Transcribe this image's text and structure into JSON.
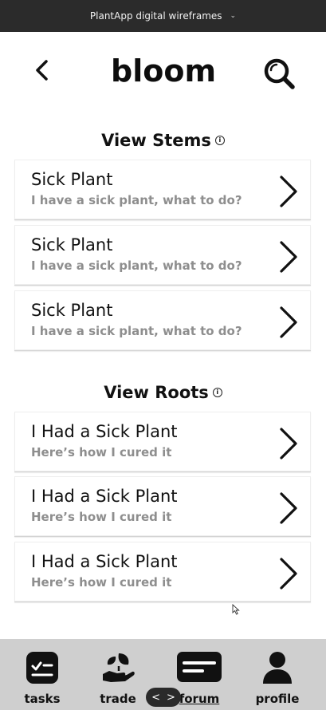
{
  "topbar": {
    "title": "PlantApp digital wireframes",
    "caret": "ˇ"
  },
  "header": {
    "logo": "bloom",
    "back_icon": "chevron-left-icon",
    "search_icon": "search-icon"
  },
  "stems": {
    "title": "View Stems",
    "items": [
      {
        "title": "Sick Plant",
        "subtitle": "I have a sick plant, what to do?"
      },
      {
        "title": "Sick Plant",
        "subtitle": "I have a sick plant, what to do?"
      },
      {
        "title": "Sick Plant",
        "subtitle": "I have a sick plant, what to do?"
      }
    ]
  },
  "roots": {
    "title": "View Roots",
    "items": [
      {
        "title": "I Had a Sick Plant",
        "subtitle": "Here’s how I cured it"
      },
      {
        "title": "I Had a Sick Plant",
        "subtitle": "Here’s how I cured it"
      },
      {
        "title": "I Had a Sick Plant",
        "subtitle": "Here’s how I cured it"
      }
    ]
  },
  "nav": {
    "items": [
      {
        "label": "tasks",
        "icon": "tasks-icon"
      },
      {
        "label": "trade",
        "icon": "trade-icon"
      },
      {
        "label": "forum",
        "icon": "forum-icon",
        "active": true
      },
      {
        "label": "profile",
        "icon": "profile-icon"
      }
    ]
  },
  "pager": {
    "prev": "<",
    "next": ">"
  },
  "colors": {
    "topbar": "#2b2b2b",
    "nav_bg": "#cfcfcf",
    "subtitle": "#8e8e8e"
  }
}
